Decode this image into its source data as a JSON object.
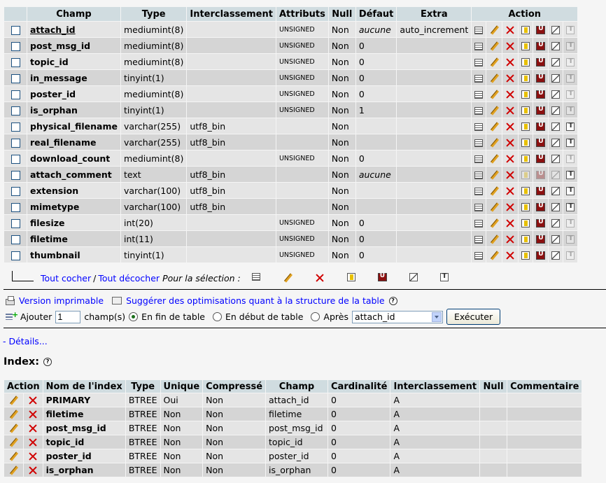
{
  "fields_table": {
    "headers": [
      "Champ",
      "Type",
      "Interclassement",
      "Attributs",
      "Null",
      "Défaut",
      "Extra",
      "Action"
    ],
    "rows": [
      {
        "name": "attach_id",
        "type": "mediumint(8)",
        "collation": "",
        "attributes": "UNSIGNED",
        "null": "Non",
        "default": "aucune",
        "default_italic": true,
        "extra": "auto_increment",
        "primary": true,
        "fulltext_enabled": false
      },
      {
        "name": "post_msg_id",
        "type": "mediumint(8)",
        "collation": "",
        "attributes": "UNSIGNED",
        "null": "Non",
        "default": "0",
        "default_italic": false,
        "extra": "",
        "primary": false,
        "fulltext_enabled": false
      },
      {
        "name": "topic_id",
        "type": "mediumint(8)",
        "collation": "",
        "attributes": "UNSIGNED",
        "null": "Non",
        "default": "0",
        "default_italic": false,
        "extra": "",
        "primary": false,
        "fulltext_enabled": false
      },
      {
        "name": "in_message",
        "type": "tinyint(1)",
        "collation": "",
        "attributes": "UNSIGNED",
        "null": "Non",
        "default": "0",
        "default_italic": false,
        "extra": "",
        "primary": false,
        "fulltext_enabled": false
      },
      {
        "name": "poster_id",
        "type": "mediumint(8)",
        "collation": "",
        "attributes": "UNSIGNED",
        "null": "Non",
        "default": "0",
        "default_italic": false,
        "extra": "",
        "primary": false,
        "fulltext_enabled": false
      },
      {
        "name": "is_orphan",
        "type": "tinyint(1)",
        "collation": "",
        "attributes": "UNSIGNED",
        "null": "Non",
        "default": "1",
        "default_italic": false,
        "extra": "",
        "primary": false,
        "fulltext_enabled": false
      },
      {
        "name": "physical_filename",
        "type": "varchar(255)",
        "collation": "utf8_bin",
        "attributes": "",
        "null": "Non",
        "default": "",
        "default_italic": false,
        "extra": "",
        "primary": false,
        "fulltext_enabled": true
      },
      {
        "name": "real_filename",
        "type": "varchar(255)",
        "collation": "utf8_bin",
        "attributes": "",
        "null": "Non",
        "default": "",
        "default_italic": false,
        "extra": "",
        "primary": false,
        "fulltext_enabled": true
      },
      {
        "name": "download_count",
        "type": "mediumint(8)",
        "collation": "",
        "attributes": "UNSIGNED",
        "null": "Non",
        "default": "0",
        "default_italic": false,
        "extra": "",
        "primary": false,
        "fulltext_enabled": false
      },
      {
        "name": "attach_comment",
        "type": "text",
        "collation": "utf8_bin",
        "attributes": "",
        "null": "Non",
        "default": "aucune",
        "default_italic": true,
        "extra": "",
        "primary": false,
        "fulltext_enabled": true,
        "disabled_keys": true
      },
      {
        "name": "extension",
        "type": "varchar(100)",
        "collation": "utf8_bin",
        "attributes": "",
        "null": "Non",
        "default": "",
        "default_italic": false,
        "extra": "",
        "primary": false,
        "fulltext_enabled": true
      },
      {
        "name": "mimetype",
        "type": "varchar(100)",
        "collation": "utf8_bin",
        "attributes": "",
        "null": "Non",
        "default": "",
        "default_italic": false,
        "extra": "",
        "primary": false,
        "fulltext_enabled": true
      },
      {
        "name": "filesize",
        "type": "int(20)",
        "collation": "",
        "attributes": "UNSIGNED",
        "null": "Non",
        "default": "0",
        "default_italic": false,
        "extra": "",
        "primary": false,
        "fulltext_enabled": false
      },
      {
        "name": "filetime",
        "type": "int(11)",
        "collation": "",
        "attributes": "UNSIGNED",
        "null": "Non",
        "default": "0",
        "default_italic": false,
        "extra": "",
        "primary": false,
        "fulltext_enabled": false
      },
      {
        "name": "thumbnail",
        "type": "tinyint(1)",
        "collation": "",
        "attributes": "UNSIGNED",
        "null": "Non",
        "default": "0",
        "default_italic": false,
        "extra": "",
        "primary": false,
        "fulltext_enabled": false
      }
    ]
  },
  "selection": {
    "check_all": "Tout cocher",
    "separator": "/",
    "uncheck_all": "Tout décocher",
    "for_selection": "Pour la sélection :"
  },
  "links": {
    "print_view": "Version imprimable",
    "propose_structure": "Suggérer des optimisations quant à la structure de la table"
  },
  "add_fields": {
    "label": "Ajouter",
    "count": "1",
    "fields_label": "champ(s)",
    "at_end": "En fin de table",
    "at_beginning": "En début de table",
    "after": "Après",
    "after_selected": "attach_id",
    "execute": "Exécuter"
  },
  "details_link": "- Détails...",
  "index_section": {
    "title": "Index:",
    "headers": [
      "Action",
      "Nom de l'index",
      "Type",
      "Unique",
      "Compressé",
      "Champ",
      "Cardinalité",
      "Interclassement",
      "Null",
      "Commentaire"
    ],
    "rows": [
      {
        "name": "PRIMARY",
        "type": "BTREE",
        "unique": "Oui",
        "packed": "Non",
        "column": "attach_id",
        "cardinality": "0",
        "collation": "A",
        "null": "",
        "comment": ""
      },
      {
        "name": "filetime",
        "type": "BTREE",
        "unique": "Non",
        "packed": "Non",
        "column": "filetime",
        "cardinality": "0",
        "collation": "A",
        "null": "",
        "comment": ""
      },
      {
        "name": "post_msg_id",
        "type": "BTREE",
        "unique": "Non",
        "packed": "Non",
        "column": "post_msg_id",
        "cardinality": "0",
        "collation": "A",
        "null": "",
        "comment": ""
      },
      {
        "name": "topic_id",
        "type": "BTREE",
        "unique": "Non",
        "packed": "Non",
        "column": "topic_id",
        "cardinality": "0",
        "collation": "A",
        "null": "",
        "comment": ""
      },
      {
        "name": "poster_id",
        "type": "BTREE",
        "unique": "Non",
        "packed": "Non",
        "column": "poster_id",
        "cardinality": "0",
        "collation": "A",
        "null": "",
        "comment": ""
      },
      {
        "name": "is_orphan",
        "type": "BTREE",
        "unique": "Non",
        "packed": "Non",
        "column": "is_orphan",
        "cardinality": "0",
        "collation": "A",
        "null": "",
        "comment": ""
      }
    ]
  },
  "colors": {
    "header_bg": "#d0dce0",
    "row_odd": "#e5e5e5",
    "row_even": "#d5d5d5",
    "link": "#0000ff"
  }
}
